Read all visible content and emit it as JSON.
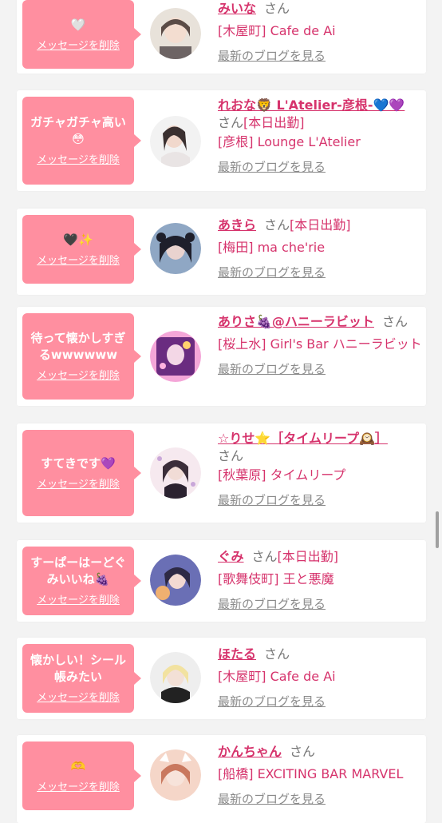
{
  "ui": {
    "delete_label": "メッセージを削除",
    "blog_label": "最新のブログを見る",
    "honorific": "さん",
    "scrollbar_color": "#a0a0a0"
  },
  "colors": {
    "bubble": "#ff8fa0",
    "accent": "#d6336c",
    "muted": "#8a8a8a"
  },
  "entries": [
    {
      "message": "🤍",
      "name": "みいな",
      "status": "",
      "shop": "[木屋町] Cafe de Ai",
      "avatar_colors": [
        "#e8e2da",
        "#5a4b46"
      ]
    },
    {
      "message": "ガチャガチャ高い😳",
      "name": "れおな🦁 L'Atelier-彦根-💙💜",
      "status": "[本日出勤]",
      "shop": "[彦根] Lounge L'Atelier",
      "avatar_colors": [
        "#f2f2f2",
        "#3a3030"
      ]
    },
    {
      "message": "🖤✨",
      "name": "あきら",
      "status": "[本日出勤]",
      "shop": "[梅田] ma che'rie",
      "avatar_colors": [
        "#8fa7c4",
        "#1e1f2b"
      ]
    },
    {
      "message": "待って懐かしすぎるwwwwww",
      "name": "ありさ🍇@ハニーラビット",
      "status": "",
      "shop": "[桜上水] Girl's Bar ハニーラビット",
      "avatar_colors": [
        "#f4a6d8",
        "#6a2c80"
      ]
    },
    {
      "message": "すてきです💜",
      "name": "☆りせ⭐️［タイムリープ🕰️］",
      "status": "",
      "shop": "[秋葉原] タイムリープ",
      "avatar_colors": [
        "#f6e9ef",
        "#3b2e3a"
      ]
    },
    {
      "message": "すーぱーはーどぐみいいね🍇",
      "name": "ぐみ",
      "status": "[本日出勤]",
      "shop": "[歌舞伎町] 王と悪魔",
      "avatar_colors": [
        "#6a6fb5",
        "#f0b070"
      ]
    },
    {
      "message": "懐かしい！シール帳みたい",
      "name": "ほたる",
      "status": "",
      "shop": "[木屋町] Cafe de Ai",
      "avatar_colors": [
        "#f2e2a0",
        "#222222"
      ]
    },
    {
      "message": "🫶",
      "name": "かんちゃん",
      "status": "",
      "shop": "[船橋] EXCITING BAR MARVEL",
      "avatar_colors": [
        "#f5d6c8",
        "#c9785e"
      ]
    }
  ]
}
